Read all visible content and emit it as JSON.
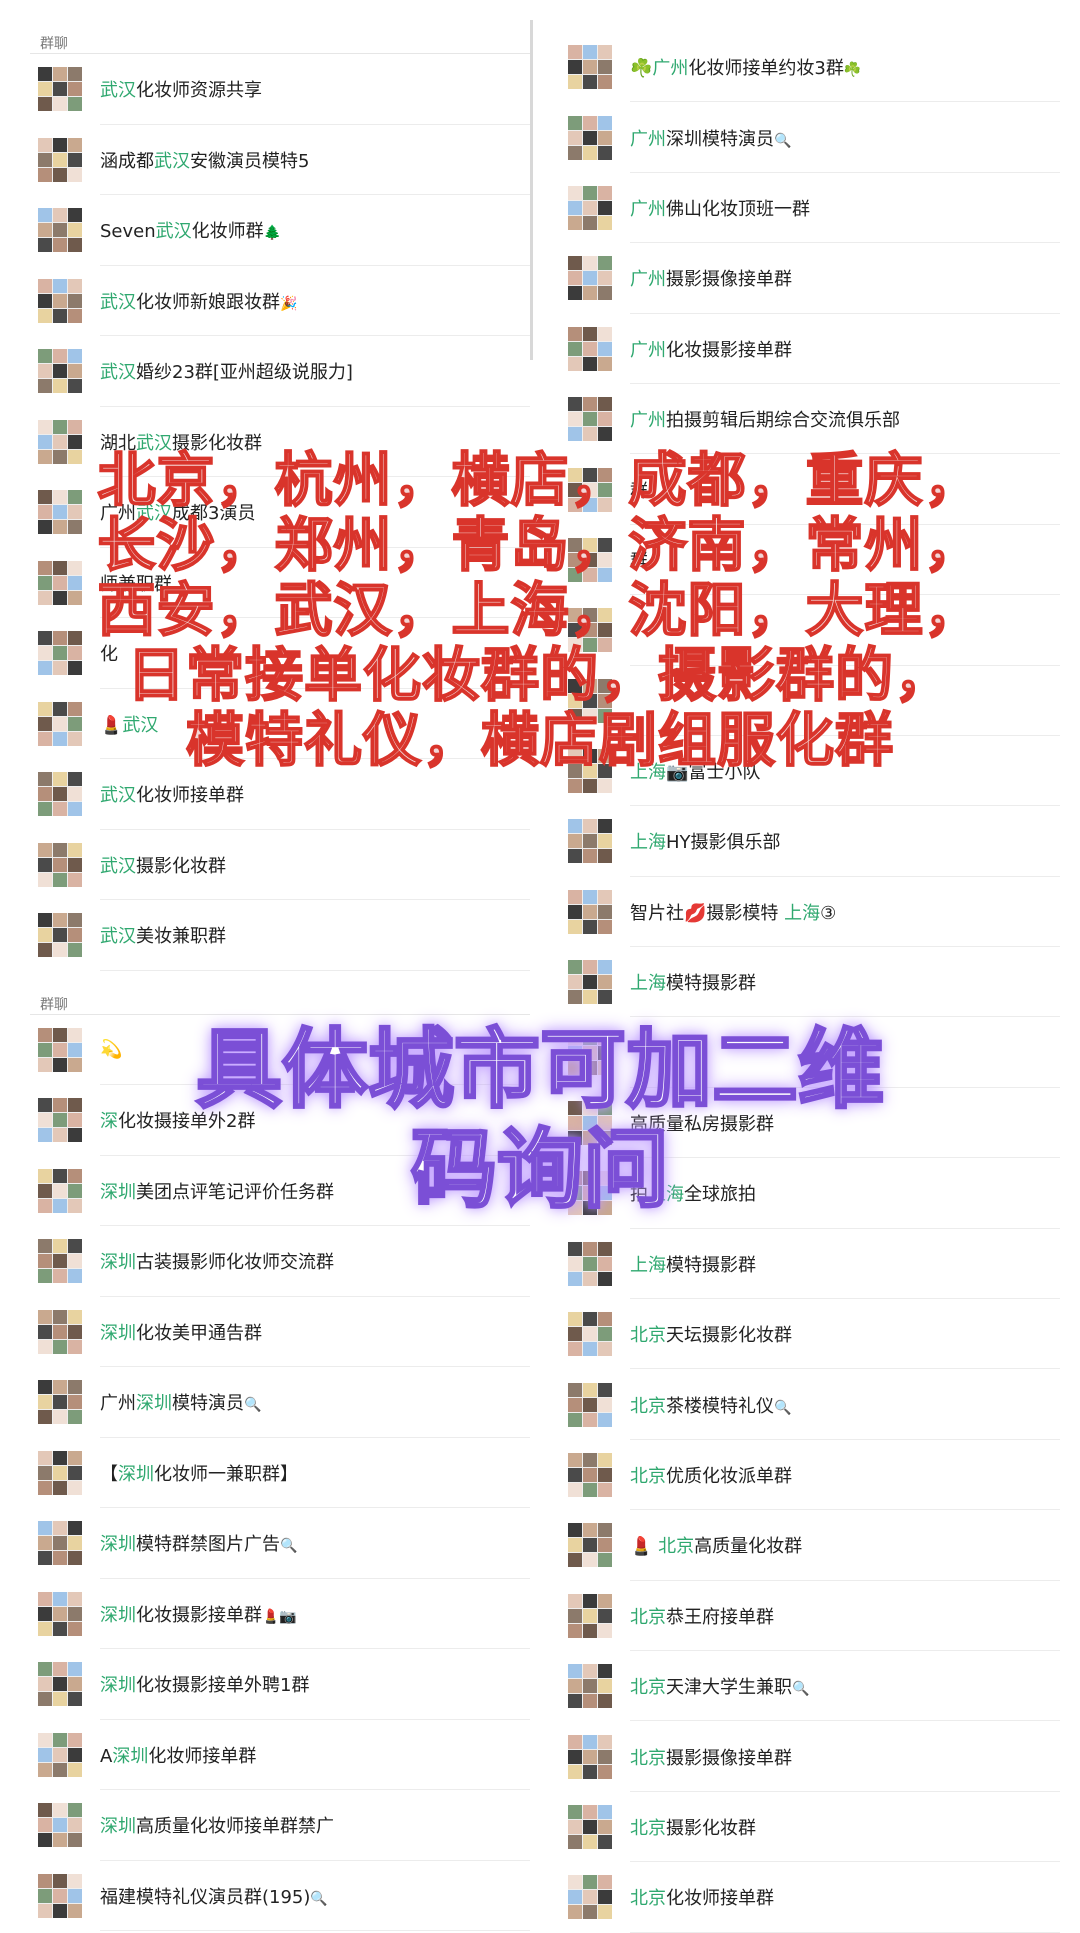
{
  "left": {
    "header1": "群聊",
    "items1": [
      {
        "pre": "",
        "hl": "武汉",
        "post": "化妆师资源共享",
        "em": ""
      },
      {
        "pre": "涵成都",
        "hl": "武汉",
        "post": "安徽演员模特5",
        "em": ""
      },
      {
        "pre": "Seven",
        "hl": "武汉",
        "post": "化妆师群",
        "em": "🌲"
      },
      {
        "pre": "",
        "hl": "武汉",
        "post": "化妆师新娘跟妆群",
        "em": "🎉"
      },
      {
        "pre": "",
        "hl": "武汉",
        "post": "婚纱23群[亚州超级说服力]",
        "em": ""
      },
      {
        "pre": "湖北",
        "hl": "武汉",
        "post": "摄影化妆群",
        "em": ""
      },
      {
        "pre": "广州",
        "hl": "武汉",
        "post": "成都3演员",
        "em": ""
      },
      {
        "pre": "",
        "hl": "",
        "post": "师兼职群",
        "em": ""
      },
      {
        "pre": "",
        "hl": "",
        "post": "化",
        "em": ""
      },
      {
        "pre": "💄",
        "hl": "武汉",
        "post": "",
        "em": ""
      },
      {
        "pre": "",
        "hl": "武汉",
        "post": "化妆师接单群",
        "em": ""
      },
      {
        "pre": "",
        "hl": "武汉",
        "post": "摄影化妆群",
        "em": ""
      },
      {
        "pre": "",
        "hl": "武汉",
        "post": "美妆兼职群",
        "em": ""
      }
    ],
    "header2": "群聊",
    "items2": [
      {
        "pre": "💫",
        "hl": "",
        "post": "",
        "em": ""
      },
      {
        "pre": "",
        "hl": "深",
        "post": "化妆摄接单外2群",
        "em": ""
      },
      {
        "pre": "",
        "hl": "深圳",
        "post": "美团点评笔记评价任务群",
        "em": ""
      },
      {
        "pre": "",
        "hl": "深圳",
        "post": "古装摄影师化妆师交流群",
        "em": ""
      },
      {
        "pre": "",
        "hl": "深圳",
        "post": "化妆美甲通告群",
        "em": ""
      },
      {
        "pre": "广州",
        "hl": "深圳",
        "post": "模特演员",
        "em": "🔍"
      },
      {
        "pre": "【",
        "hl": "深圳",
        "post": "化妆师一兼职群】",
        "em": ""
      },
      {
        "pre": "",
        "hl": "深圳",
        "post": "模特群禁图片广告",
        "em": "🔍"
      },
      {
        "pre": "",
        "hl": "深圳",
        "post": "化妆摄影接单群",
        "em": "💄📷"
      },
      {
        "pre": "",
        "hl": "深圳",
        "post": "化妆摄影接单外聘1群",
        "em": ""
      },
      {
        "pre": "A",
        "hl": "深圳",
        "post": "化妆师接单群",
        "em": ""
      },
      {
        "pre": "",
        "hl": "深圳",
        "post": "高质量化妆师接单群禁广",
        "em": ""
      },
      {
        "pre": "福建模特礼仪演员群(195)",
        "hl": "",
        "post": "",
        "em": "🔍"
      }
    ]
  },
  "right": {
    "items": [
      {
        "pre": "☘️",
        "hl": "广州",
        "post": "化妆师接单约妆3群",
        "em": "☘️"
      },
      {
        "pre": "",
        "hl": "广州",
        "post": "深圳模特演员",
        "em": "🔍"
      },
      {
        "pre": "",
        "hl": "广州",
        "post": "佛山化妆顶班一群",
        "em": ""
      },
      {
        "pre": "",
        "hl": "广州",
        "post": "摄影摄像接单群",
        "em": ""
      },
      {
        "pre": "",
        "hl": "广州",
        "post": "化妆摄影接单群",
        "em": ""
      },
      {
        "pre": "",
        "hl": "广州",
        "post": "拍摄剪辑后期综合交流俱乐部",
        "em": ""
      },
      {
        "pre": "",
        "hl": "",
        "post": "群",
        "em": ""
      },
      {
        "pre": "",
        "hl": "",
        "post": "群",
        "em": ""
      },
      {
        "pre": "",
        "hl": "",
        "post": "",
        "em": ""
      },
      {
        "pre": "",
        "hl": "",
        "post": "",
        "em": ""
      },
      {
        "pre": "",
        "hl": "上海",
        "post": "📷富士小队",
        "em": ""
      },
      {
        "pre": "",
        "hl": "上海",
        "post": "HY摄影俱乐部",
        "em": ""
      },
      {
        "pre": "智片社💋摄影模特 ",
        "hl": "上海",
        "post": "③",
        "em": ""
      },
      {
        "pre": "",
        "hl": "上海",
        "post": "模特摄影群",
        "em": ""
      },
      {
        "pre": "",
        "hl": "",
        "post": "",
        "em": ""
      },
      {
        "pre": "",
        "hl": "",
        "post": "高质量私房摄影群",
        "em": ""
      },
      {
        "pre": "拍",
        "hl": "上海",
        "post": "全球旅拍",
        "em": ""
      },
      {
        "pre": "",
        "hl": "上海",
        "post": "模特摄影群",
        "em": ""
      },
      {
        "pre": "",
        "hl": "北京",
        "post": "天坛摄影化妆群",
        "em": ""
      },
      {
        "pre": "",
        "hl": "北京",
        "post": "茶楼模特礼仪",
        "em": "🔍"
      },
      {
        "pre": "",
        "hl": "北京",
        "post": "优质化妆派单群",
        "em": ""
      },
      {
        "pre": "💄 ",
        "hl": "北京",
        "post": "高质量化妆群",
        "em": ""
      },
      {
        "pre": "",
        "hl": "北京",
        "post": "恭王府接单群",
        "em": ""
      },
      {
        "pre": "",
        "hl": "北京",
        "post": "天津大学生兼职",
        "em": "🔍"
      },
      {
        "pre": "",
        "hl": "北京",
        "post": "摄影摄像接单群",
        "em": ""
      },
      {
        "pre": "",
        "hl": "北京",
        "post": "摄影化妆群",
        "em": ""
      },
      {
        "pre": "",
        "hl": "北京",
        "post": "化妆师接单群",
        "em": ""
      }
    ]
  },
  "overlay_top": [
    "北京，杭州，横店，成都，重庆，",
    "长沙，郑州，青岛，济南，常州，",
    "西安，武汉，上海，沈阳，大理，",
    "日常接单化妆群的，摄影群的，",
    "模特礼仪，横店剧组服化群"
  ],
  "overlay_bottom": [
    "具体城市可加二维",
    "码询问"
  ]
}
